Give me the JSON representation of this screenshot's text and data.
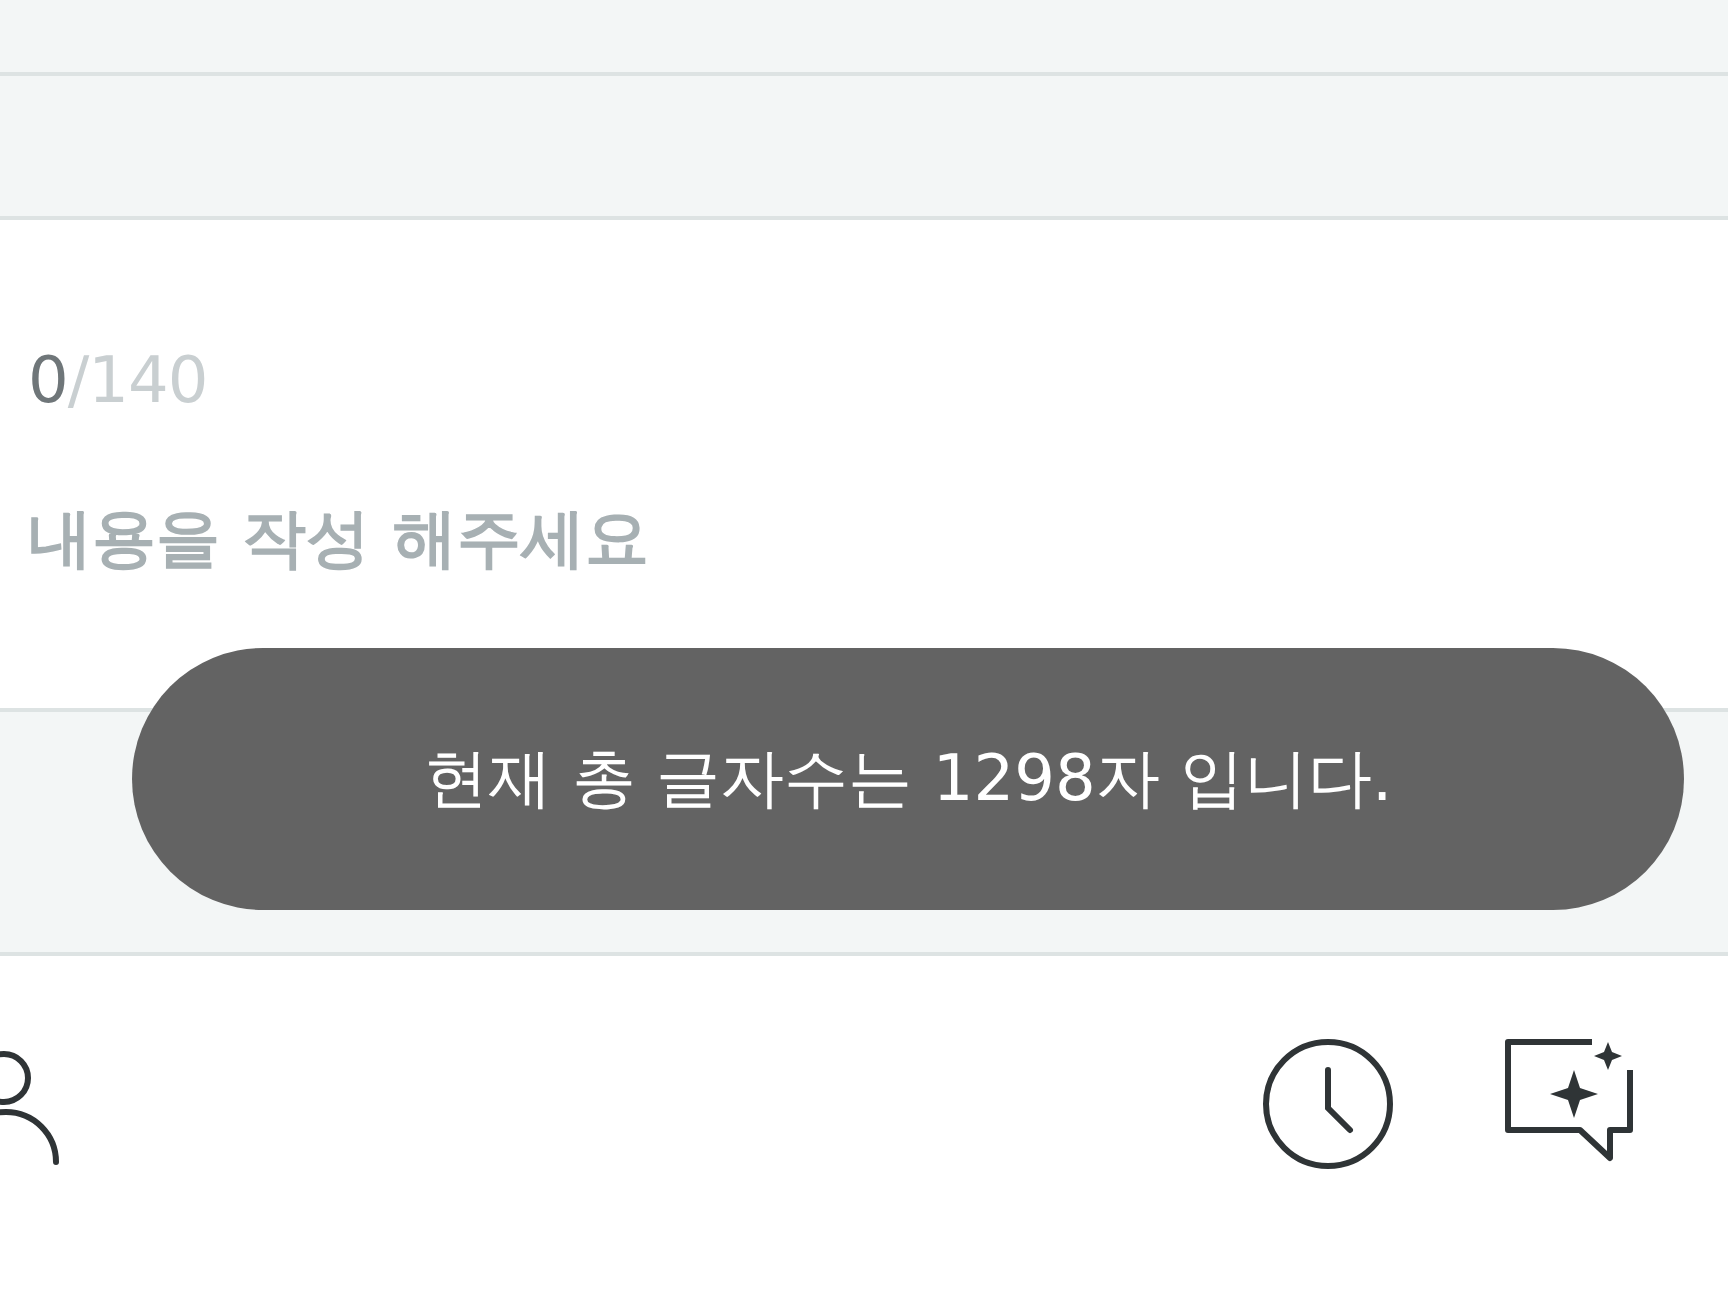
{
  "counter": {
    "count": "0",
    "limit": "/140"
  },
  "editor": {
    "placeholder": "내용을 작성 해주세요"
  },
  "toast": {
    "message": "현재 총 글자수는 1298자 입니다."
  }
}
